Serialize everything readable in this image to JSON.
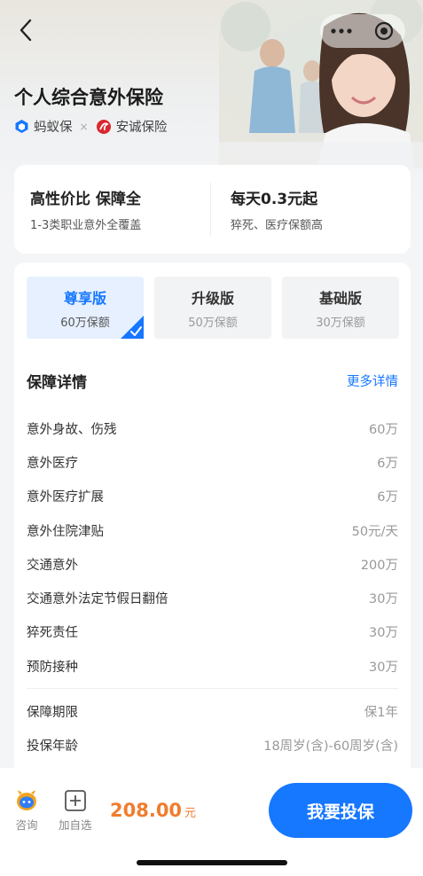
{
  "header": {
    "title": "个人综合意外保险",
    "brand1": "蚂蚁保",
    "separator": "×",
    "brand2": "安诚保险"
  },
  "highlights": [
    {
      "title": "高性价比 保障全",
      "subtitle": "1-3类职业意外全覆盖"
    },
    {
      "title": "每天0.3元起",
      "subtitle": "猝死、医疗保额高"
    }
  ],
  "plans": [
    {
      "name": "尊享版",
      "coverage": "60万保额",
      "selected": true
    },
    {
      "name": "升级版",
      "coverage": "50万保额",
      "selected": false
    },
    {
      "name": "基础版",
      "coverage": "30万保额",
      "selected": false
    }
  ],
  "details": {
    "title": "保障详情",
    "more": "更多详情",
    "items": [
      {
        "label": "意外身故、伤残",
        "value": "60万"
      },
      {
        "label": "意外医疗",
        "value": "6万"
      },
      {
        "label": "意外医疗扩展",
        "value": "6万"
      },
      {
        "label": "意外住院津贴",
        "value": "50元/天"
      },
      {
        "label": "交通意外",
        "value": "200万"
      },
      {
        "label": "交通意外法定节假日翻倍",
        "value": "30万"
      },
      {
        "label": "猝死责任",
        "value": "30万"
      },
      {
        "label": "预防接种",
        "value": "30万"
      }
    ],
    "extra": [
      {
        "label": "保障期限",
        "value": "保1年"
      },
      {
        "label": "投保年龄",
        "value": "18周岁(含)-60周岁(含)"
      }
    ]
  },
  "bottom": {
    "consult": "咨询",
    "add_watch": "加自选",
    "price": "208.00",
    "unit": "元",
    "buy": "我要投保"
  },
  "colors": {
    "accent": "#1677ff",
    "price": "#f07c2d",
    "selected_bg": "#e6f0ff"
  }
}
